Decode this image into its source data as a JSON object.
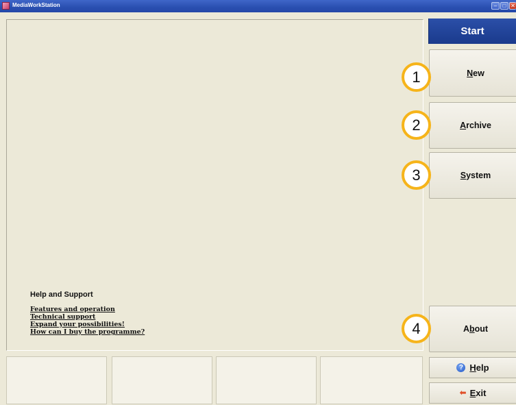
{
  "window": {
    "title": "MediaWorkStation",
    "controls": {
      "minimize": "–",
      "maximize": "□",
      "close": "✕"
    }
  },
  "help_section": {
    "heading": "Help and Support",
    "links": [
      "Features and operation",
      "Technical support",
      "Expand your possibilities!",
      "How can I buy the programme?"
    ]
  },
  "sidebar": {
    "header": "Start",
    "buttons": [
      {
        "mnemonic": "N",
        "rest": "ew",
        "callout": "1"
      },
      {
        "mnemonic": "A",
        "rest": "rchive",
        "callout": "2"
      },
      {
        "mnemonic": "S",
        "rest": "ystem",
        "callout": "3"
      },
      {
        "prefix": "A",
        "mnemonic": "b",
        "rest": "out",
        "callout": "4"
      }
    ],
    "help": {
      "mnemonic": "H",
      "rest": "elp",
      "icon": "help-icon",
      "icon_glyph": "?"
    },
    "exit": {
      "mnemonic": "E",
      "rest": "xit",
      "icon": "exit-arrow-icon",
      "icon_glyph": "⬅"
    }
  },
  "colors": {
    "background": "#ece9d8",
    "titlebar": "#2a4fb0",
    "sidebar_header": "#1f3f96",
    "callout_border": "#f6b41a"
  }
}
